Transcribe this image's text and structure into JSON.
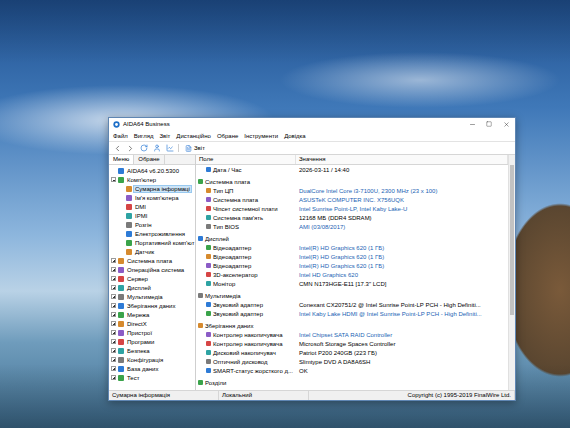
{
  "window": {
    "title": "AIDA64 Business"
  },
  "menu": [
    "Файл",
    "Вигляд",
    "Звіт",
    "Дистанційно",
    "Обране",
    "Інструменти",
    "Довідка"
  ],
  "toolbar": {
    "report_button": "Звіт"
  },
  "sidebar": {
    "tabs": [
      {
        "label": "Меню",
        "selected": true
      },
      {
        "label": "Обране",
        "selected": false
      }
    ],
    "items": [
      {
        "label": "AIDA64 v6.20.5300",
        "kind": "root",
        "selected": false
      },
      {
        "label": "Комп'ютер",
        "kind": "branch",
        "expanded": true,
        "selected": false,
        "children": [
          {
            "label": "Сумарна інформаці",
            "kind": "leaf",
            "selected": true
          },
          {
            "label": "Ім'я комп'ютера",
            "kind": "leaf",
            "selected": false
          },
          {
            "label": "DMI",
            "kind": "leaf",
            "selected": false
          },
          {
            "label": "IPMI",
            "kind": "leaf",
            "selected": false
          },
          {
            "label": "Розгін",
            "kind": "leaf",
            "selected": false
          },
          {
            "label": "Електроживлення",
            "kind": "leaf",
            "selected": false
          },
          {
            "label": "Портативний комп'ют",
            "kind": "leaf",
            "selected": false
          },
          {
            "label": "Датчик",
            "kind": "leaf",
            "selected": false
          }
        ]
      },
      {
        "label": "Системна плата",
        "kind": "branch",
        "expanded": false,
        "selected": false
      },
      {
        "label": "Операційна система",
        "kind": "branch",
        "expanded": false,
        "selected": false
      },
      {
        "label": "Сервер",
        "kind": "branch",
        "expanded": false,
        "selected": false
      },
      {
        "label": "Дисплей",
        "kind": "branch",
        "expanded": false,
        "selected": false
      },
      {
        "label": "Мультимедіа",
        "kind": "branch",
        "expanded": false,
        "selected": false
      },
      {
        "label": "Зберігання даних",
        "kind": "branch",
        "expanded": false,
        "selected": false
      },
      {
        "label": "Мережа",
        "kind": "branch",
        "expanded": false,
        "selected": false
      },
      {
        "label": "DirectX",
        "kind": "branch",
        "expanded": false,
        "selected": false
      },
      {
        "label": "Пристрої",
        "kind": "branch",
        "expanded": false,
        "selected": false
      },
      {
        "label": "Програми",
        "kind": "branch",
        "expanded": false,
        "selected": false
      },
      {
        "label": "Безпека",
        "kind": "branch",
        "expanded": false,
        "selected": false
      },
      {
        "label": "Конфігурація",
        "kind": "branch",
        "expanded": false,
        "selected": false
      },
      {
        "label": "База даних",
        "kind": "branch",
        "expanded": false,
        "selected": false
      },
      {
        "label": "Тест",
        "kind": "branch",
        "expanded": false,
        "selected": false
      }
    ]
  },
  "table": {
    "columns": [
      "Поле",
      "Значення"
    ],
    "rows": [
      {
        "kind": "item",
        "field": "Дата / Час",
        "value": "2026-03-11 / 14:40",
        "link": false
      },
      {
        "kind": "group",
        "field": "Системна плата"
      },
      {
        "kind": "item",
        "field": "Тип ЦП",
        "value": "DualCore Intel Core i3-7100U, 2300 MHz (23 x 100)",
        "link": true
      },
      {
        "kind": "item",
        "field": "Системна плата",
        "value": "ASUSTeK COMPUTER INC. X756UQK",
        "link": true
      },
      {
        "kind": "item",
        "field": "Чіпсет системної плати",
        "value": "Intel Sunrise Point-LP, Intel Kaby Lake-U",
        "link": true
      },
      {
        "kind": "item",
        "field": "Системна пам'ять",
        "value": "12168 МБ (DDR4 SDRAM)",
        "link": false
      },
      {
        "kind": "item",
        "field": "Тип BIOS",
        "value": "AMI (03/08/2017)",
        "link": true
      },
      {
        "kind": "group",
        "field": "Дисплей"
      },
      {
        "kind": "item",
        "field": "Відеоадаптер",
        "value": "Intel(R) HD Graphics 620 (1 ГБ)",
        "link": true
      },
      {
        "kind": "item",
        "field": "Відеоадаптер",
        "value": "Intel(R) HD Graphics 620 (1 ГБ)",
        "link": true
      },
      {
        "kind": "item",
        "field": "Відеоадаптер",
        "value": "Intel(R) HD Graphics 620 (1 ГБ)",
        "link": true
      },
      {
        "kind": "item",
        "field": "3D-акселератор",
        "value": "Intel HD Graphics 620",
        "link": true
      },
      {
        "kind": "item",
        "field": "Монітор",
        "value": "CMN N173HGE-E11 [17.3\" LCD]",
        "link": false
      },
      {
        "kind": "group",
        "field": "Мультимедіа"
      },
      {
        "kind": "item",
        "field": "Звуковий адаптер",
        "value": "Conexant CX20751/2 @ Intel Sunrise Point-LP PCH - High Definiti...",
        "link": false
      },
      {
        "kind": "item",
        "field": "Звуковий адаптер",
        "value": "Intel Kaby Lake HDMI @ Intel Sunrise Point-LP PCH - High Definiti...",
        "link": true
      },
      {
        "kind": "group",
        "field": "Зберігання даних"
      },
      {
        "kind": "item",
        "field": "Контролер накопичувача",
        "value": "Intel Chipset SATA RAID Controller",
        "link": true
      },
      {
        "kind": "item",
        "field": "Контролер накопичувача",
        "value": "Microsoft Storage Spaces Controller",
        "link": false
      },
      {
        "kind": "item",
        "field": "Дисковий накопичувач",
        "value": "Patriot P200 240GB (223 ГБ)",
        "link": false
      },
      {
        "kind": "item",
        "field": "Оптичний дисковод",
        "value": "Slimtype DVD A DA8A6SH",
        "link": false
      },
      {
        "kind": "item",
        "field": "SMART-статус жорсткого д...",
        "value": "OK",
        "link": false
      },
      {
        "kind": "group",
        "field": "Розділи"
      }
    ]
  },
  "status_bar": [
    "Сумарна інформація",
    "Локальний",
    "Copyright (c) 1995-2019 FinalWire Ltd."
  ]
}
